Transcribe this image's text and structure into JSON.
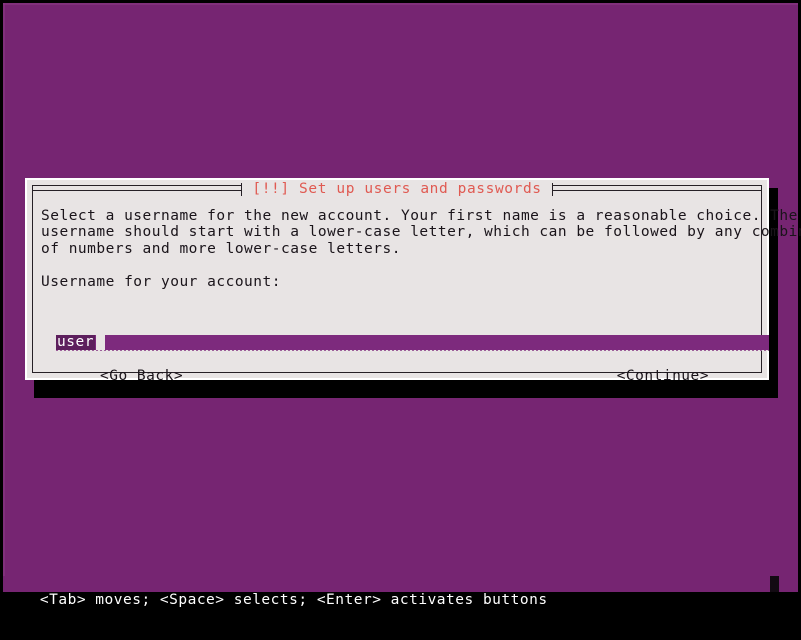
{
  "screen": {
    "background_color": "#762572",
    "frame_color": "#000000"
  },
  "dialog": {
    "title": "[!!] Set up users and passwords",
    "title_color": "#e05a52",
    "background_color": "#e8e4e4",
    "border_color": "#ffffff",
    "body_lines": [
      "Select a username for the new account. Your first name is a reasonable choice. The",
      "username should start with a lower-case letter, which can be followed by any combination",
      "of numbers and more lower-case letters."
    ],
    "prompt_label": "Username for your account:",
    "input": {
      "value": "user",
      "selected_text": "user",
      "field_color": "#7d2a7d",
      "selection_color": "#5d1f5d",
      "cursor_color": "#e8e4e4"
    },
    "buttons": {
      "go_back": "<Go Back>",
      "continue": "<Continue>"
    }
  },
  "status_bar": {
    "text": "<Tab> moves; <Space> selects; <Enter> activates buttons",
    "background_color": "#762572",
    "text_color": "#ffffff"
  }
}
